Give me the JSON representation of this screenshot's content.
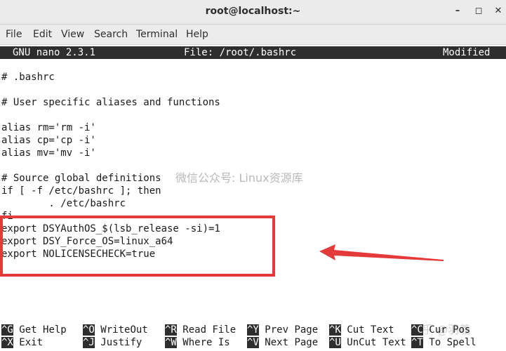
{
  "window": {
    "title": "root@localhost:~",
    "controls": [
      "–",
      "◻",
      "✕"
    ]
  },
  "menu": [
    "File",
    "Edit",
    "View",
    "Search",
    "Terminal",
    "Help"
  ],
  "nano_header": {
    "version": "GNU nano 2.3.1",
    "file": "File: /root/.bashrc",
    "status": "Modified"
  },
  "lines": [
    "# .bashrc",
    "",
    "# User specific aliases and functions",
    "",
    "alias rm='rm -i'",
    "alias cp='cp -i'",
    "alias mv='mv -i'",
    "",
    "# Source global definitions",
    "if [ -f /etc/bashrc ]; then",
    "        . /etc/bashrc",
    "fi",
    "export DSYAuthOS_$(lsb_release -si)=1",
    "export DSY_Force_OS=linux_a64",
    "export NOLICENSECHECK=true"
  ],
  "shortcuts_row1": [
    {
      "key": "^G",
      "label": "Get Help"
    },
    {
      "key": "^O",
      "label": "WriteOut"
    },
    {
      "key": "^R",
      "label": "Read File"
    },
    {
      "key": "^Y",
      "label": "Prev Page"
    },
    {
      "key": "^K",
      "label": "Cut Text"
    },
    {
      "key": "^C",
      "label": "Cur Pos"
    }
  ],
  "shortcuts_row2": [
    {
      "key": "^X",
      "label": "Exit"
    },
    {
      "key": "^J",
      "label": "Justify"
    },
    {
      "key": "^W",
      "label": "Where Is"
    },
    {
      "key": "^V",
      "label": "Next Page"
    },
    {
      "key": "^U",
      "label": "UnCut Text"
    },
    {
      "key": "^T",
      "label": "To Spell"
    }
  ],
  "watermarks": {
    "center": "微信公众号: Linux资源库",
    "bottom_right": "知乎 @羽羲"
  },
  "colors": {
    "highlight_border": "#e53a3a",
    "arrow": "#e53a3a",
    "header_bg": "#2e2e2e"
  }
}
